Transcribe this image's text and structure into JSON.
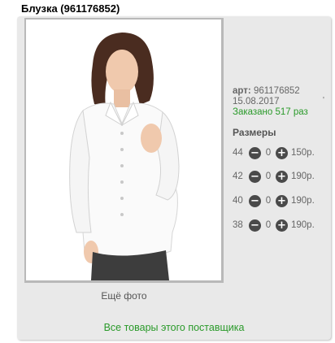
{
  "product": {
    "title": "Блузка (961176852)",
    "more_photos": "Ещё фото",
    "art": "961176852",
    "date": "15.08.2017",
    "ordered": "Заказано 517 раз",
    "sizes_title": "Размеры",
    "sizes": [
      {
        "size": "44",
        "qty": "0",
        "price": "150р."
      },
      {
        "size": "42",
        "qty": "0",
        "price": "190р."
      },
      {
        "size": "40",
        "qty": "0",
        "price": "190р."
      },
      {
        "size": "38",
        "qty": "0",
        "price": "190р."
      }
    ],
    "supplier_link": "Все товары этого поставщика"
  },
  "labels": {
    "art_prefix": "арт:",
    "minus": "−",
    "plus": "+"
  },
  "colors": {
    "panel": "#e9e9e9",
    "link_green": "#2a9a2a",
    "button_dark": "#4a4a4a"
  }
}
